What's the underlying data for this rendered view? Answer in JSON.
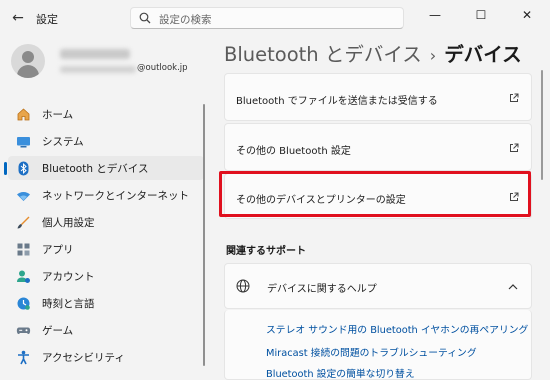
{
  "window": {
    "title": "設定",
    "back_icon": "back-arrow-icon"
  },
  "search": {
    "placeholder": "設定の検索"
  },
  "window_controls": {
    "minimize": "—",
    "maximize": "☐",
    "close": "✕"
  },
  "account": {
    "email_domain": "@outlook.jp"
  },
  "nav": {
    "items": [
      {
        "label": "ホーム",
        "icon": "home-icon",
        "active": false
      },
      {
        "label": "システム",
        "icon": "system-icon",
        "active": false
      },
      {
        "label": "Bluetooth とデバイス",
        "icon": "bluetooth-icon",
        "active": true
      },
      {
        "label": "ネットワークとインターネット",
        "icon": "network-icon",
        "active": false
      },
      {
        "label": "個人用設定",
        "icon": "personalization-icon",
        "active": false
      },
      {
        "label": "アプリ",
        "icon": "apps-icon",
        "active": false
      },
      {
        "label": "アカウント",
        "icon": "accounts-icon",
        "active": false
      },
      {
        "label": "時刻と言語",
        "icon": "time-language-icon",
        "active": false
      },
      {
        "label": "ゲーム",
        "icon": "gaming-icon",
        "active": false
      },
      {
        "label": "アクセシビリティ",
        "icon": "accessibility-icon",
        "active": false
      }
    ]
  },
  "breadcrumb": {
    "parent": "Bluetooth とデバイス",
    "separator": "›",
    "current": "デバイス"
  },
  "settings_links": [
    {
      "label": "Bluetooth でファイルを送信または受信する"
    },
    {
      "label": "その他の Bluetooth 設定"
    },
    {
      "label": "その他のデバイスとプリンターの設定",
      "highlighted": true
    }
  ],
  "support": {
    "section_title": "関連するサポート",
    "help_title": "デバイスに関するヘルプ",
    "links": [
      "ステレオ サウンド用の Bluetooth イヤホンの再ペアリング",
      "Miracast 接続の問題のトラブルシューティング",
      "Bluetooth 設定の簡単な切り替え"
    ]
  },
  "colors": {
    "accent": "#0067c0",
    "highlight": "#e0101e",
    "link": "#0050a0"
  }
}
